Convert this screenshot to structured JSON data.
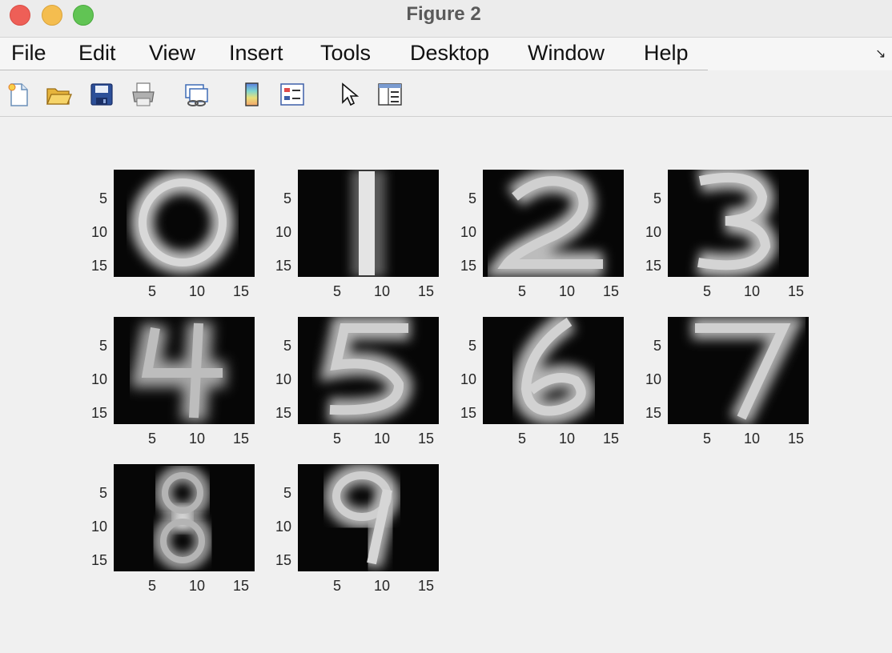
{
  "window": {
    "title": "Figure 2"
  },
  "menu": [
    "File",
    "Edit",
    "View",
    "Insert",
    "Tools",
    "Desktop",
    "Window",
    "Help"
  ],
  "toolbar": {
    "buttons": [
      "new-figure-icon",
      "open-file-icon",
      "save-icon",
      "print-icon",
      "link-plot-icon",
      "insert-colorbar-icon",
      "insert-legend-icon",
      "edit-plot-arrow-icon",
      "open-property-inspector-icon"
    ]
  },
  "colors": {
    "background": "#f0f0f0",
    "close": "#ee5f57",
    "minimize": "#f4bd4f",
    "zoom": "#61c454"
  },
  "chart_data": {
    "type": "heatmap",
    "colormap": "gray",
    "grid": "3x4 subplots, 10 used",
    "ytick_labels": [
      "5",
      "10",
      "15"
    ],
    "xtick_labels": [
      "5",
      "10",
      "15"
    ],
    "xlim": [
      0.5,
      16.5
    ],
    "ylim": [
      0.5,
      16.5
    ],
    "subplots": [
      "0",
      "1",
      "2",
      "3",
      "4",
      "5",
      "6",
      "7",
      "8",
      "9"
    ]
  }
}
